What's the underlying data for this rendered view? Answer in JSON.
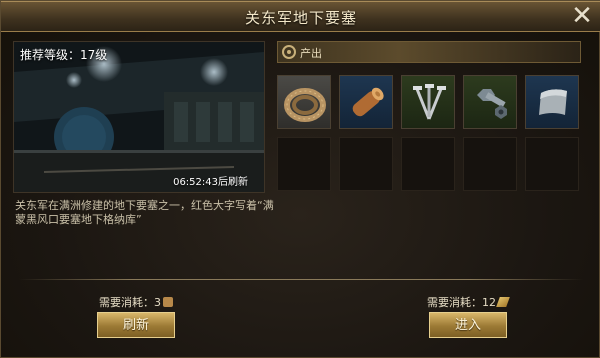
{
  "window": {
    "title": "关东军地下要塞"
  },
  "scene": {
    "level_text": "推荐等级：17级",
    "refresh_timer": "06:52:43后刷新"
  },
  "description": "关东军在满洲修建的地下要塞之一，红色大字写着“满蒙黑风口要塞地下格纳库”",
  "output": {
    "label": "产出",
    "items": [
      {
        "icon": "rope-icon",
        "bg": "grey"
      },
      {
        "icon": "wood-log-icon",
        "bg": "blue"
      },
      {
        "icon": "nails-icon",
        "bg": "green"
      },
      {
        "icon": "bolt-nut-icon",
        "bg": "green"
      },
      {
        "icon": "steel-plate-icon",
        "bg": "blue"
      }
    ],
    "empty_slots": 5
  },
  "refresh_action": {
    "cost_label": "需要消耗：3",
    "button_label": "刷新"
  },
  "enter_action": {
    "cost_label": "需要消耗：12",
    "button_label": "进入"
  },
  "colors": {
    "accent_gold": "#c8a65a",
    "title_bar": "#5a4a2e"
  }
}
